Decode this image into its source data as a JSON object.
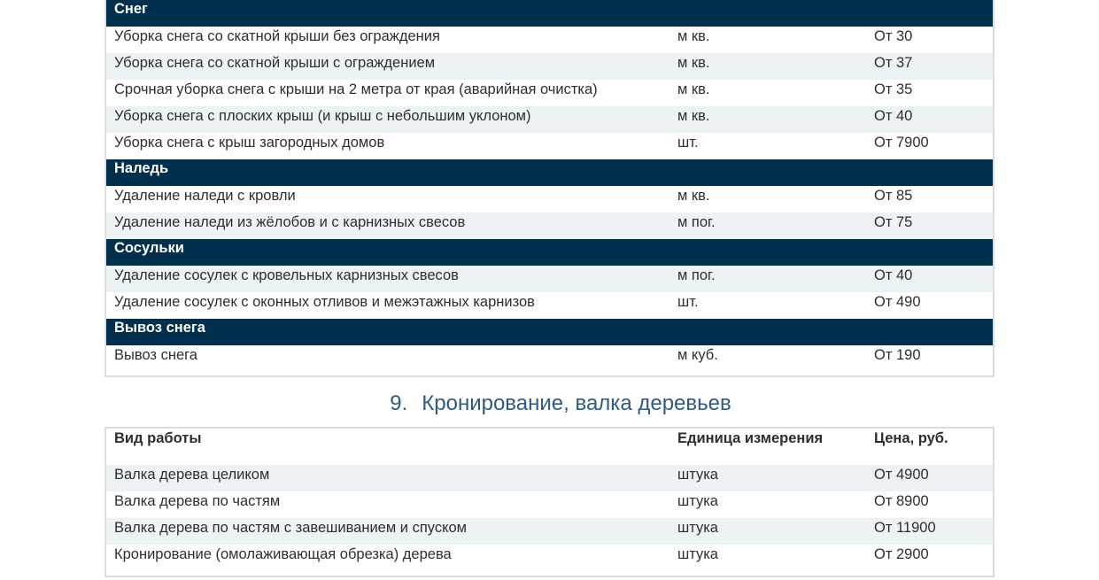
{
  "snow_table": {
    "groups": [
      {
        "title": "Снег",
        "rows": [
          {
            "work": "Уборка снега со скатной крыши без ограждения",
            "unit": "м кв.",
            "price": "От 30"
          },
          {
            "work": "Уборка снега со скатной крыши с ограждением",
            "unit": "м кв.",
            "price": "От 37"
          },
          {
            "work": "Срочная уборка снега с крыши на 2 метра от края (аварийная очистка)",
            "unit": "м кв.",
            "price": "От 35"
          },
          {
            "work": "Уборка снега с плоских крыш (и крыш с небольшим уклоном)",
            "unit": "м кв.",
            "price": "От 40"
          },
          {
            "work": "Уборка снега с крыш загородных домов",
            "unit": "шт.",
            "price": "От 7900"
          }
        ]
      },
      {
        "title": "Наледь",
        "rows": [
          {
            "work": "Удаление наледи с кровли",
            "unit": "м кв.",
            "price": "От 85"
          },
          {
            "work": "Удаление наледи из жёлобов и с карнизных свесов",
            "unit": "м пог.",
            "price": "От 75"
          }
        ]
      },
      {
        "title": "Сосульки",
        "rows": [
          {
            "work": "Удаление сосулек с кровельных карнизных свесов",
            "unit": "м пог.",
            "price": "От 40"
          },
          {
            "work": "Удаление сосулек с оконных отливов и межэтажных карнизов",
            "unit": "шт.",
            "price": "От 490"
          }
        ]
      },
      {
        "title": "Вывоз снега",
        "rows": [
          {
            "work": "Вывоз снега",
            "unit": "м куб.",
            "price": "От 190"
          }
        ]
      }
    ]
  },
  "section_9": {
    "number": "9.",
    "title": "Кронирование, валка деревьев"
  },
  "trees_table": {
    "headers": {
      "work": "Вид работы",
      "unit": "Единица измерения",
      "price": "Цена, руб."
    },
    "rows": [
      {
        "work": "Валка дерева целиком",
        "unit": "штука",
        "price": "От 4900"
      },
      {
        "work": "Валка дерева по частям",
        "unit": "штука",
        "price": "От 8900"
      },
      {
        "work": "Валка дерева по частям с завешиванием и спуском",
        "unit": "штука",
        "price": "От 11900"
      },
      {
        "work": "Кронирование (омолаживающая обрезка) дерева",
        "unit": "штука",
        "price": "От 2900"
      }
    ]
  },
  "colors": {
    "section_header_bg": "#01304f",
    "zebra_row_bg": "#edf3f5",
    "heading_color": "#2f5a84"
  }
}
